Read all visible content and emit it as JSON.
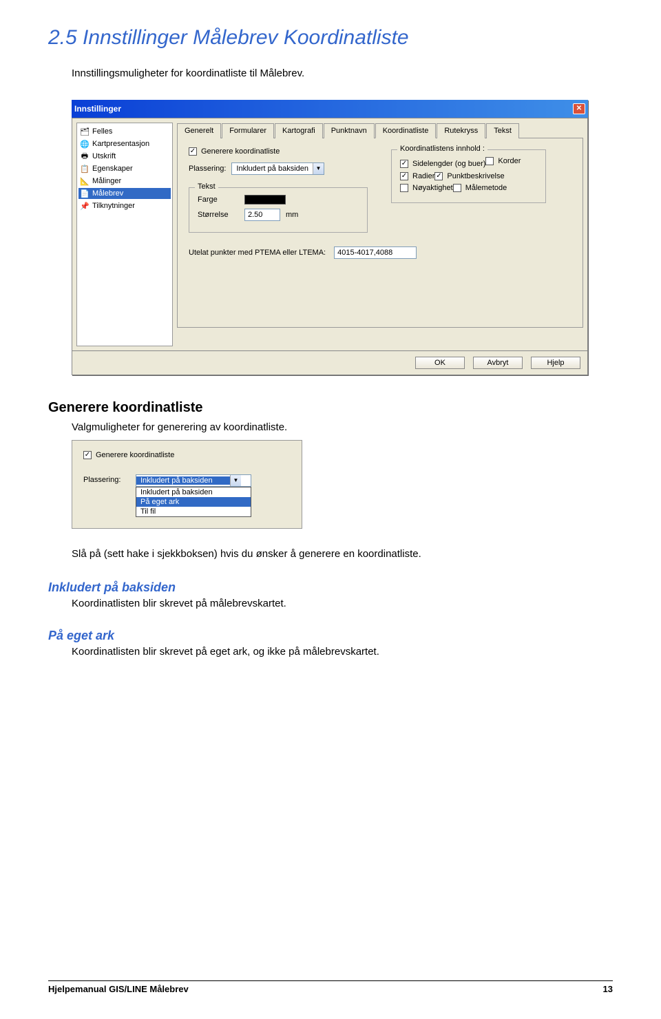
{
  "heading": "2.5 Innstillinger Målebrev Koordinatliste",
  "intro": "Innstillingsmuligheter for koordinatliste til Målebrev.",
  "dialog": {
    "title": "Innstillinger",
    "tree": [
      "Felles",
      "Kartpresentasjon",
      "Utskrift",
      "Egenskaper",
      "Målinger",
      "Målebrev",
      "Tilknytninger"
    ],
    "tabs": [
      "Generelt",
      "Formularer",
      "Kartografi",
      "Punktnavn",
      "Koordinatliste",
      "Rutekryss",
      "Tekst"
    ],
    "active_tab": 4,
    "gen_koord": "Generere koordinatliste",
    "plassering_label": "Plassering:",
    "plassering_value": "Inkludert på baksiden",
    "tekst_group": "Tekst",
    "farge_label": "Farge",
    "storrelse_label": "Størrelse",
    "storrelse_value": "2.50",
    "storrelse_unit": "mm",
    "content_group": "Koordinatlistens innhold :",
    "content_items": [
      {
        "label": "Sidelengder (og buer)",
        "checked": true
      },
      {
        "label": "Korder",
        "checked": false
      },
      {
        "label": "Radier",
        "checked": true
      },
      {
        "label": "Punktbeskrivelse",
        "checked": true
      },
      {
        "label": "Nøyaktighet",
        "checked": false
      },
      {
        "label": "Målemetode",
        "checked": false
      }
    ],
    "utelat_label": "Utelat punkter med PTEMA eller LTEMA:",
    "utelat_value": "4015-4017,4088",
    "btn_ok": "OK",
    "btn_avbryt": "Avbryt",
    "btn_hjelp": "Hjelp"
  },
  "sec2": {
    "title": "Generere koordinatliste",
    "text": "Valgmuligheter for generering av koordinatliste.",
    "check": "Generere koordinatliste",
    "plass_label": "Plassering:",
    "combo_value": "Inkludert på baksiden",
    "options": [
      "Inkludert på baksiden",
      "På eget ark",
      "Til fil"
    ],
    "desc": "Slå på (sett hake i sjekkboksen) hvis du ønsker å generere en koordinatliste."
  },
  "sec3a": {
    "title": "Inkludert på baksiden",
    "text": "Koordinatlisten blir skrevet på målebrevskartet."
  },
  "sec3b": {
    "title": "På eget ark",
    "text": "Koordinatlisten blir skrevet på eget ark, og ikke på målebrevskartet."
  },
  "footer": {
    "left": "Hjelpemanual GIS/LINE Målebrev",
    "right": "13"
  }
}
